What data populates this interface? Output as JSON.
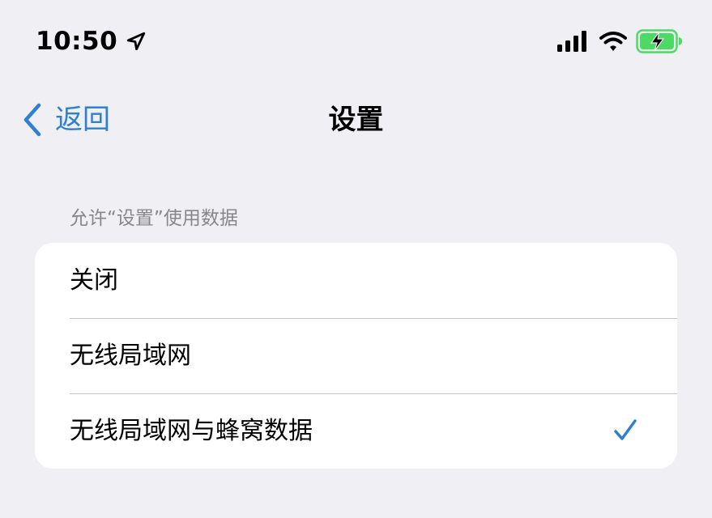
{
  "status_bar": {
    "time": "10:50",
    "icons": [
      "location-arrow-icon",
      "cellular-signal-icon",
      "wifi-icon",
      "battery-charging-icon"
    ]
  },
  "nav": {
    "back_label": "返回",
    "title": "设置"
  },
  "section": {
    "header": "允许“设置”使用数据",
    "options": [
      {
        "label": "关闭",
        "selected": false
      },
      {
        "label": "无线局域网",
        "selected": false
      },
      {
        "label": "无线局域网与蜂窝数据",
        "selected": true
      }
    ]
  },
  "colors": {
    "background": "#efeff4",
    "accent": "#2f7fd3",
    "battery": "#4cd964",
    "secondary_text": "#86868b"
  }
}
